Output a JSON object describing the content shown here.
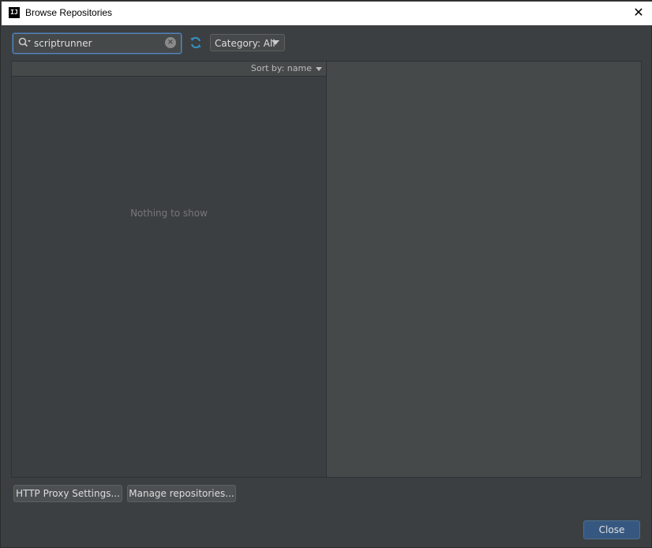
{
  "window": {
    "title": "Browse Repositories",
    "app_icon_glyph": "IJ",
    "close_glyph": "✕"
  },
  "toolbar": {
    "search": {
      "value": "scriptrunner",
      "placeholder": ""
    },
    "category_label": "Category: All"
  },
  "list": {
    "sort_label": "Sort by: name",
    "empty_text": "Nothing to show"
  },
  "footer": {
    "proxy_label": "HTTP Proxy Settings...",
    "manage_label": "Manage repositories...",
    "close_label": "Close"
  },
  "icons": {
    "search": "search-icon",
    "clear": "clear-icon",
    "refresh": "refresh-icon",
    "chevron": "chevron-down-icon"
  },
  "colors": {
    "background": "#3c3f41",
    "accent": "#3592c4",
    "primary_button": "#365880"
  }
}
